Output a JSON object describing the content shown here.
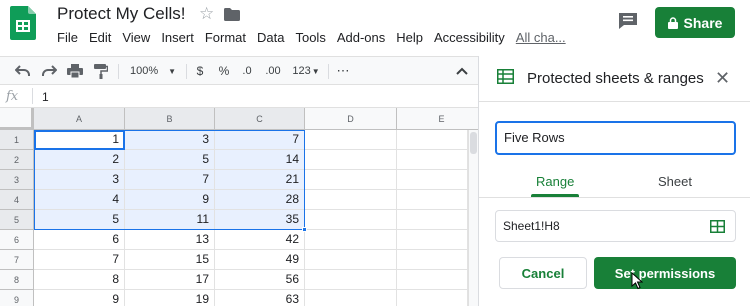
{
  "app": {
    "title": "Protect My Cells!",
    "icons": [
      "sheets-logo-icon",
      "star-icon",
      "folder-icon",
      "comment-icon",
      "lock-icon"
    ]
  },
  "menu": [
    "File",
    "Edit",
    "View",
    "Insert",
    "Format",
    "Data",
    "Tools",
    "Add-ons",
    "Help",
    "Accessibility"
  ],
  "menu_link": "All cha...",
  "share_label": "Share",
  "toolbar": {
    "zoom": "100%",
    "currency": "$",
    "percent": "%",
    "dec_decrease": ".0",
    "dec_increase": ".00",
    "format_more": "123",
    "more": "⋯",
    "icons": [
      "undo-icon",
      "redo-icon",
      "print-icon",
      "paint-format-icon",
      "chevron-up-icon"
    ]
  },
  "formula_bar": {
    "fx": "fx",
    "value": "1"
  },
  "grid": {
    "columns": [
      "A",
      "B",
      "C",
      "D",
      "E"
    ],
    "rows": [
      {
        "n": "1",
        "a": "1",
        "b": "3",
        "c": "7"
      },
      {
        "n": "2",
        "a": "2",
        "b": "5",
        "c": "14"
      },
      {
        "n": "3",
        "a": "3",
        "b": "7",
        "c": "21"
      },
      {
        "n": "4",
        "a": "4",
        "b": "9",
        "c": "28"
      },
      {
        "n": "5",
        "a": "5",
        "b": "11",
        "c": "35"
      },
      {
        "n": "6",
        "a": "6",
        "b": "13",
        "c": "42"
      },
      {
        "n": "7",
        "a": "7",
        "b": "15",
        "c": "49"
      },
      {
        "n": "8",
        "a": "8",
        "b": "17",
        "c": "56"
      },
      {
        "n": "9",
        "a": "9",
        "b": "19",
        "c": "63"
      }
    ],
    "selection": "A1:C5"
  },
  "panel": {
    "title": "Protected sheets & ranges",
    "description_value": "Five Rows",
    "tabs": [
      {
        "label": "Range",
        "active": true
      },
      {
        "label": "Sheet",
        "active": false
      }
    ],
    "range_value": "Sheet1!H8",
    "cancel_label": "Cancel",
    "set_permissions_label": "Set permissions"
  },
  "colors": {
    "brand_green": "#188038",
    "selection_blue": "#1a73e8",
    "selection_fill": "#e8f0fe"
  }
}
